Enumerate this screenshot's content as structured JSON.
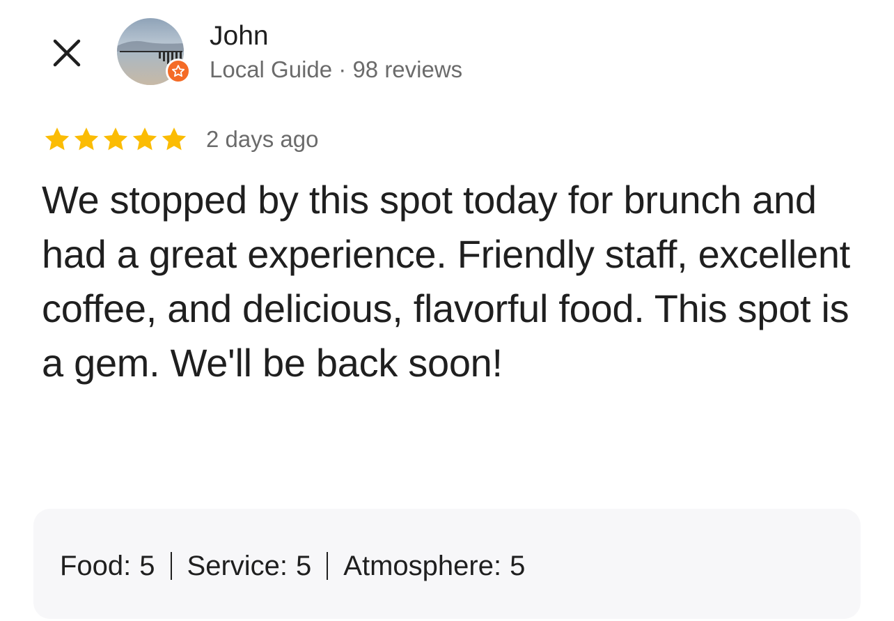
{
  "reviewer": {
    "name": "John",
    "meta": "Local Guide · 98 reviews",
    "badge_color": "#f46b26"
  },
  "review": {
    "stars": 5,
    "max_stars": 5,
    "star_color": "#fbbc04",
    "time_ago": "2 days ago",
    "text": "We stopped by this spot today for brunch and had a great experience. Friendly staff, excellent coffee, and delicious, flavorful food. This spot is a gem. We'll be back soon!"
  },
  "sub_ratings": [
    {
      "label": "Food:",
      "value": "5"
    },
    {
      "label": "Service:",
      "value": "5"
    },
    {
      "label": "Atmosphere:",
      "value": "5"
    }
  ],
  "icons": {
    "close": "close-icon",
    "avatar": "avatar",
    "badge": "local-guide-star-icon",
    "star": "star-icon"
  }
}
